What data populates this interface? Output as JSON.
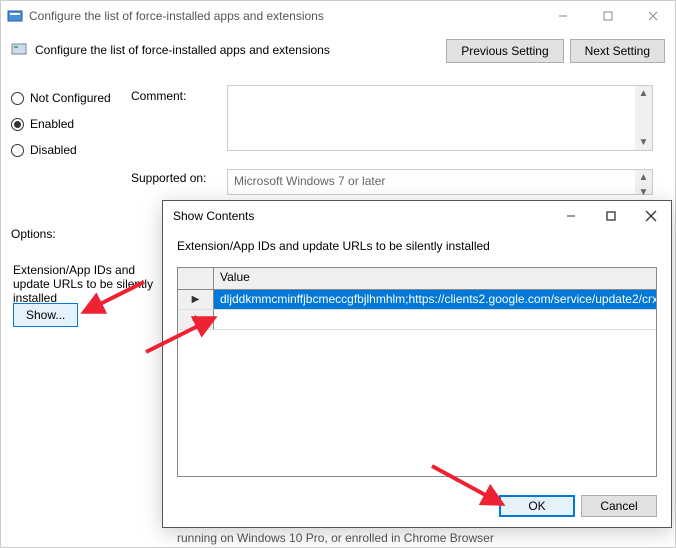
{
  "window": {
    "title": "Configure the list of force-installed apps and extensions",
    "policy_title": "Configure the list of force-installed apps and extensions",
    "nav": {
      "prev": "Previous Setting",
      "next": "Next Setting"
    }
  },
  "radio": {
    "not_configured": "Not Configured",
    "enabled": "Enabled",
    "disabled": "Disabled",
    "selected": "enabled"
  },
  "labels": {
    "comment": "Comment:",
    "supported_on": "Supported on:",
    "options": "Options:"
  },
  "supported_text": "Microsoft Windows 7 or later",
  "options": {
    "desc": "Extension/App IDs and update URLs to be silently installed",
    "show_button": "Show..."
  },
  "bottom_truncated": "running on Windows 10 Pro, or enrolled in Chrome Browser",
  "dialog": {
    "title": "Show Contents",
    "subtitle": "Extension/App IDs and update URLs to be silently installed",
    "column_header": "Value",
    "row_value": "dljddkmmcminffjbcmeccgfbjlhmhlm;https://clients2.google.com/service/update2/crx",
    "ok": "OK",
    "cancel": "Cancel"
  }
}
